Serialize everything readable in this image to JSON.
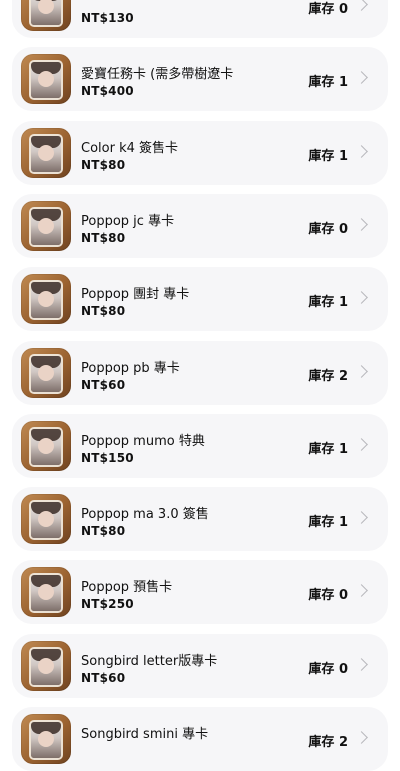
{
  "products": [
    {
      "name": "",
      "price": "NT$130",
      "stock": "庫存 0"
    },
    {
      "name": "愛寶任務卡 (需多帶樹遼卡",
      "price": "NT$400",
      "stock": "庫存 1"
    },
    {
      "name": "Color k4 簽售卡",
      "price": "NT$80",
      "stock": "庫存 1"
    },
    {
      "name": "Poppop jc 專卡",
      "price": "NT$80",
      "stock": "庫存 0"
    },
    {
      "name": "Poppop 團封 專卡",
      "price": "NT$80",
      "stock": "庫存 1"
    },
    {
      "name": "Poppop pb 專卡",
      "price": "NT$60",
      "stock": "庫存 2"
    },
    {
      "name": "Poppop mumo 特典",
      "price": "NT$150",
      "stock": "庫存 1"
    },
    {
      "name": "Poppop ma 3.0 簽售",
      "price": "NT$80",
      "stock": "庫存 1"
    },
    {
      "name": "Poppop 預售卡",
      "price": "NT$250",
      "stock": "庫存 0"
    },
    {
      "name": "Songbird letter版專卡",
      "price": "NT$60",
      "stock": "庫存 0"
    },
    {
      "name": "Songbird smini 專卡",
      "price": "",
      "stock": "庫存 2"
    }
  ],
  "icons": {
    "thumbnail": "photocard-thumbnail",
    "chevron": "chevron-right-icon"
  },
  "colors": {
    "card_background": "#f6f6f8",
    "chevron": "#b8b8bc"
  }
}
